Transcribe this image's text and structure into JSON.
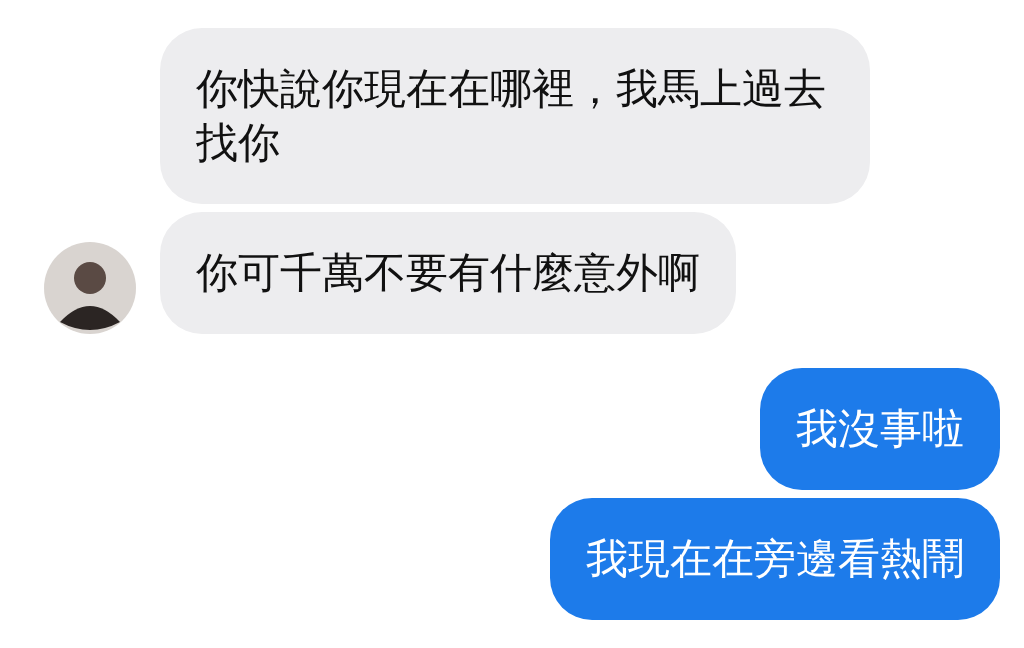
{
  "messages": [
    {
      "kind": "received",
      "text": "你快說你現在在哪裡，我馬上過去找你",
      "avatar": false
    },
    {
      "kind": "received",
      "text": "你可千萬不要有什麼意外啊",
      "avatar": true
    },
    {
      "kind": "sent",
      "text": "我沒事啦",
      "avatar": false
    },
    {
      "kind": "sent",
      "text": "我現在在旁邊看熱鬧",
      "avatar": false
    }
  ]
}
